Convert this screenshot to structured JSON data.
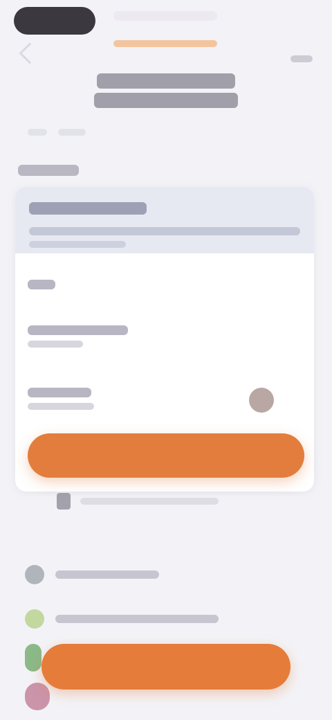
{
  "header": {
    "title_line_1": "",
    "title_line_2": ""
  },
  "card": {
    "primary_button_label": ""
  },
  "bottom": {
    "cta_label": ""
  },
  "colors": {
    "accent": "#e27d3e",
    "background": "#f3f3f7",
    "card": "#ffffff"
  },
  "icons": {
    "back": "chevron-left-icon",
    "menu": "more-icon"
  }
}
